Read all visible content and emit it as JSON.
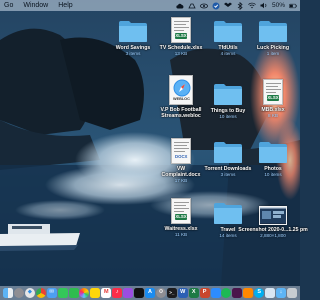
{
  "menubar": {
    "items": [
      "Go",
      "Window",
      "Help"
    ],
    "battery": "50%"
  },
  "desktop": {
    "icons": [
      {
        "name": "Word Savings",
        "sub": "3 items",
        "kind": "folder"
      },
      {
        "name": "TV Schedule.xlsx",
        "sub": "13 KB",
        "kind": "xlsx",
        "tag": "XLSX"
      },
      {
        "name": "TfdUtils",
        "sub": "4 items",
        "kind": "folder"
      },
      {
        "name": "Luck Picking",
        "sub": "1 item",
        "kind": "folder"
      },
      {
        "name": "V.P Bob Football Streams.webloc",
        "sub": "",
        "kind": "webloc",
        "tag": "WEBLOC"
      },
      {
        "name": "Things to Buy",
        "sub": "10 items",
        "kind": "folder"
      },
      {
        "name": "MBB.xlsx",
        "sub": "8 KB",
        "kind": "xlsx",
        "tag": "XLSX"
      },
      {
        "name": "VW Complaint.docx",
        "sub": "17 KB",
        "kind": "docx",
        "tag": "DOCX"
      },
      {
        "name": "Torrent Downloads",
        "sub": "3 items",
        "kind": "folder"
      },
      {
        "name": "Photos",
        "sub": "10 items",
        "kind": "folder"
      },
      {
        "name": "Waitress.xlsx",
        "sub": "11 KB",
        "kind": "xlsx",
        "tag": "XLSX"
      },
      {
        "name": "Travel",
        "sub": "14 items",
        "kind": "folder"
      },
      {
        "name": "Screenshot 2020-0...1.25 pm",
        "sub": "2,880×1,800",
        "kind": "screenshot"
      }
    ]
  },
  "dock": {
    "apps": [
      "Finder",
      "Launchpad",
      "Safari",
      "Chrome",
      "Mail",
      "Messages",
      "FaceTime",
      "Photos",
      "Notes",
      "Calendar",
      "Music",
      "Podcasts",
      "TV",
      "App Store",
      "Preferences",
      "Terminal",
      "Word",
      "Excel",
      "PowerPoint",
      "Zoom",
      "Spotify",
      "Slack",
      "VLC",
      "Skype",
      "Preview",
      "Downloads",
      "Trash"
    ]
  },
  "colors": {
    "folder": "#62b8ec",
    "excel": "#1d7a45",
    "word": "#2b5fb4",
    "selection": "#2a63c9"
  }
}
